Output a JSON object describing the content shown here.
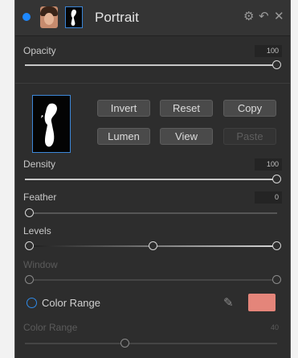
{
  "header": {
    "title": "Portrait",
    "icons": [
      "layer-dot-icon",
      "portrait-thumbnail-icon",
      "mask-thumbnail-icon",
      "gear-icon",
      "undo-icon",
      "close-icon"
    ],
    "gear_glyph": "⚙",
    "undo_glyph": "↶",
    "close_glyph": "✕"
  },
  "opacity": {
    "label": "Opacity",
    "value": "100",
    "level": 1.0
  },
  "mask_buttons": {
    "invert": "Invert",
    "reset": "Reset",
    "copy": "Copy",
    "lumen": "Lumen",
    "view": "View",
    "paste": "Paste"
  },
  "density": {
    "label": "Density",
    "value": "100",
    "level": 1.0
  },
  "feather": {
    "label": "Feather",
    "value": "0",
    "level": 0.0
  },
  "levels": {
    "label": "Levels",
    "low": 0.0,
    "mid": 0.5,
    "high": 1.0
  },
  "window": {
    "label": "Window",
    "low": 0.0,
    "high": 1.0
  },
  "color_range_toggle": {
    "label": "Color Range",
    "swatch_color": "#e4857a"
  },
  "color_range_slider": {
    "label": "Color Range",
    "value": "40",
    "level": 0.4
  },
  "colors": {
    "accent": "#1e88ff",
    "panel": "#2d2d2d"
  }
}
